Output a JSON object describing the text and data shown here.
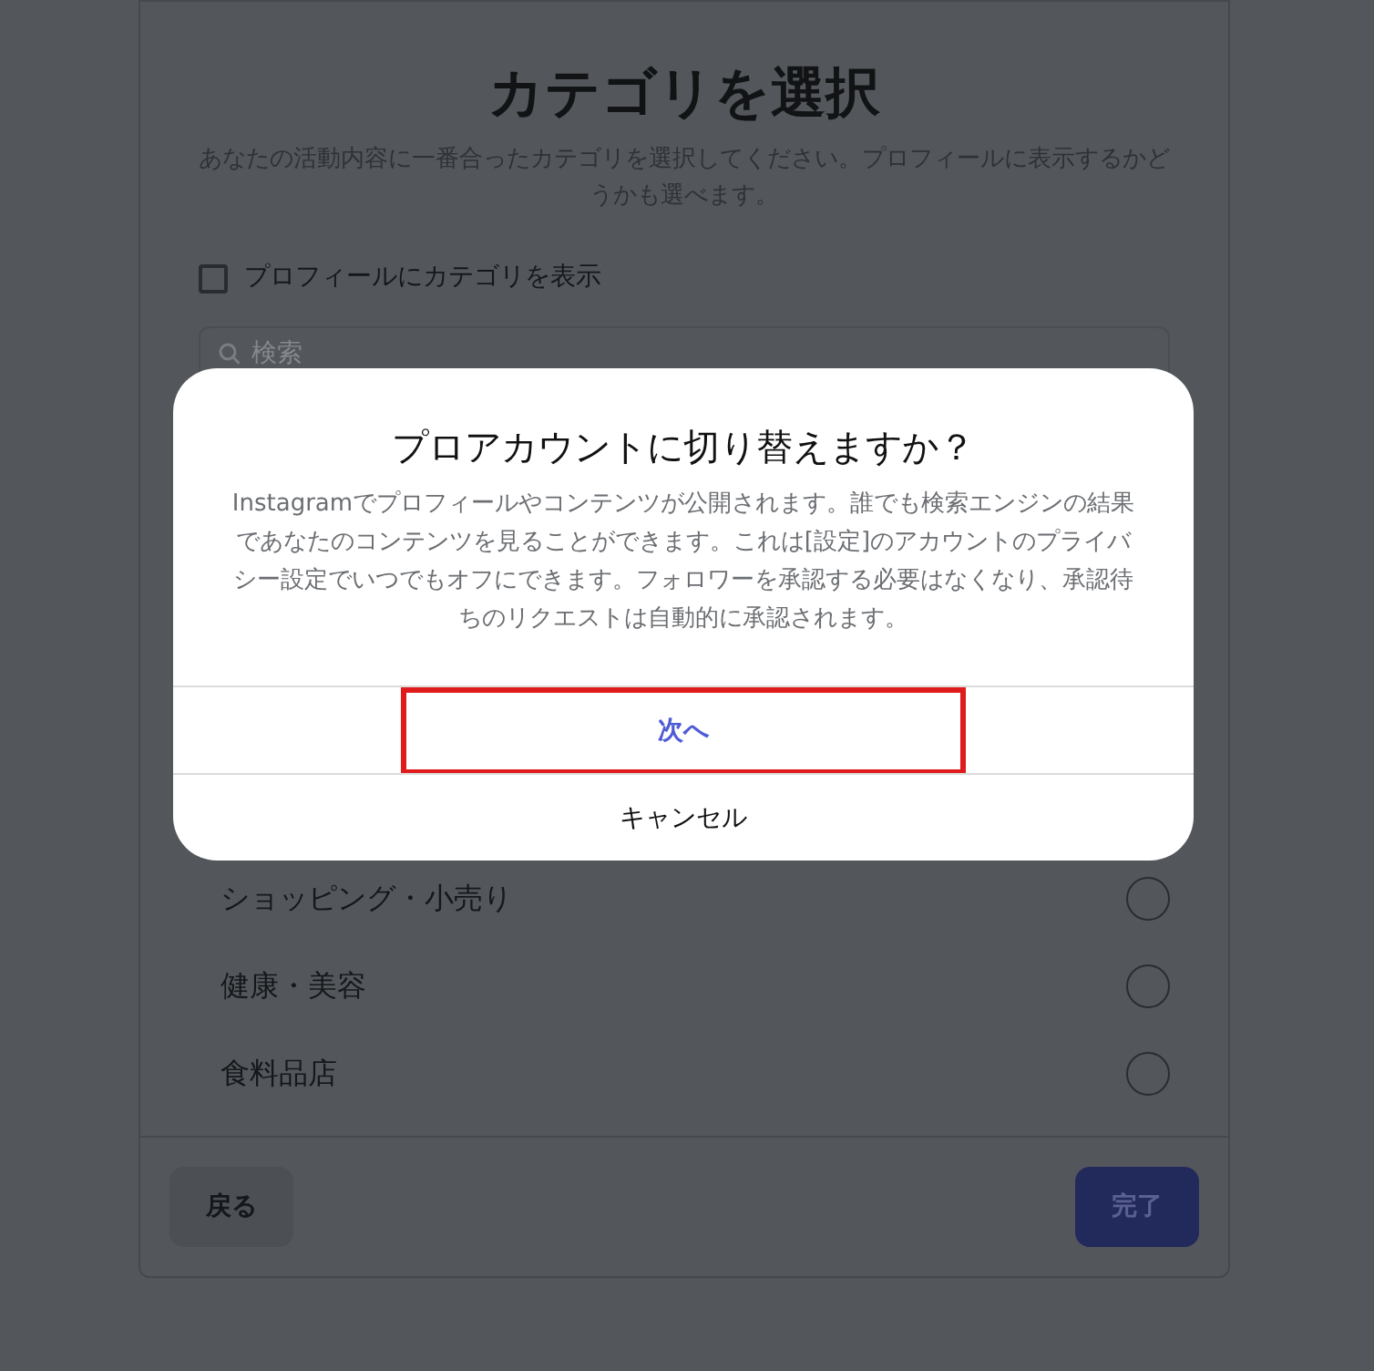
{
  "page": {
    "title": "カテゴリを選択",
    "subtitle": "あなたの活動内容に一番合ったカテゴリを選択してください。プロフィールに表示するかどうかも選べます。",
    "show_category": {
      "label": "プロフィールにカテゴリを表示",
      "checked": false
    },
    "search": {
      "placeholder": "検索"
    },
    "categories": [
      {
        "label": "ショッピング・小売り",
        "selected": false
      },
      {
        "label": "健康・美容",
        "selected": false
      },
      {
        "label": "食料品店",
        "selected": false
      }
    ],
    "back_button": "戻る",
    "done_button": "完了"
  },
  "dialog": {
    "title": "プロアカウントに切り替えますか？",
    "body": "Instagramでプロフィールやコンテンツが公開されます。誰でも検索エンジンの結果であなたのコンテンツを見ることができます。これは[設定]のアカウントのプライバシー設定でいつでもオフにできます。フォロワーを承認する必要はなくなり、承認待ちのリクエストは自動的に承認されます。",
    "actions": [
      {
        "label": "次へ",
        "kind": "primary",
        "highlighted": true
      },
      {
        "label": "キャンセル",
        "kind": "secondary",
        "highlighted": false
      }
    ]
  }
}
